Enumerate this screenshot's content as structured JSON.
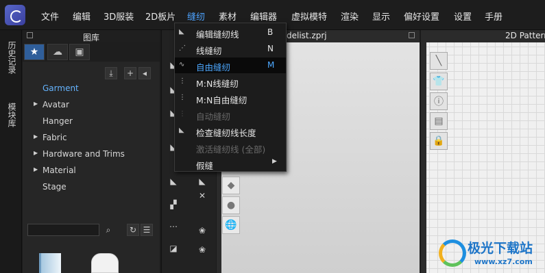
{
  "menubar": {
    "items": [
      "文件",
      "编辑",
      "3D服装",
      "2D板片",
      "缝纫",
      "素材",
      "编辑器",
      "虚拟模特",
      "渲染",
      "显示",
      "偏好设置",
      "设置",
      "手册"
    ],
    "active": "缝纫"
  },
  "side_tabs": [
    "历史记录",
    "模块库"
  ],
  "library": {
    "title": "图库",
    "tree": [
      {
        "label": "Garment",
        "expandable": false,
        "highlight": true
      },
      {
        "label": "Avatar",
        "expandable": true
      },
      {
        "label": "Hanger",
        "expandable": false
      },
      {
        "label": "Fabric",
        "expandable": true
      },
      {
        "label": "Hardware and Trims",
        "expandable": true
      },
      {
        "label": "Material",
        "expandable": true
      },
      {
        "label": "Stage",
        "expandable": false
      }
    ],
    "search": {
      "value": "",
      "placeholder": ""
    }
  },
  "viewport": {
    "title": "delist.zprj"
  },
  "pattern": {
    "title": "2D Pattern"
  },
  "dropdown": {
    "items": [
      {
        "label": "编辑缝纫线",
        "key": "B",
        "state": "normal"
      },
      {
        "label": "线缝纫",
        "key": "N",
        "state": "normal"
      },
      {
        "label": "自由缝纫",
        "key": "M",
        "state": "selected"
      },
      {
        "label": "M:N线缝纫",
        "key": "",
        "state": "normal"
      },
      {
        "label": "M:N自由缝纫",
        "key": "",
        "state": "normal"
      },
      {
        "label": "自动缝纫",
        "key": "",
        "state": "disabled"
      },
      {
        "label": "检查缝纫线长度",
        "key": "",
        "state": "normal"
      },
      {
        "label": "激活缝纫线 (全部)",
        "key": "",
        "state": "disabled"
      },
      {
        "label": "假缝",
        "key": "",
        "state": "submenu"
      }
    ]
  },
  "watermark": {
    "name": "极光下载站",
    "url": "www.xz7.com"
  },
  "colors": {
    "accent": "#4da3ff",
    "menu_bg": "#1d1d1d",
    "panel_bg": "#262626"
  }
}
